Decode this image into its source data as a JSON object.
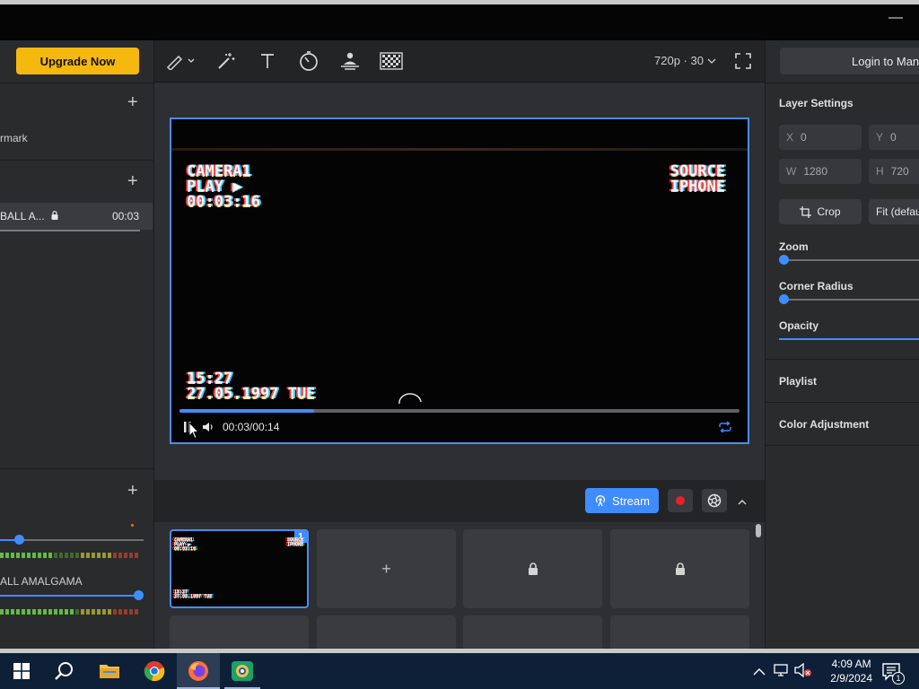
{
  "left_panel": {
    "upgrade_label": "Upgrade Now",
    "layers_item": "rmark",
    "source_item": {
      "name": "BALL A...",
      "time": "00:03"
    },
    "audio_item": "ALL AMALGAMA"
  },
  "toolbar": {
    "resolution": "720p · 30",
    "tools": [
      "pen-icon",
      "magic-wand-icon",
      "text-icon",
      "timer-icon",
      "presenter-icon",
      "mosaic-icon"
    ]
  },
  "preview": {
    "vhs_top_left": [
      "CAMERA1",
      "PLAY ▶",
      "00:03:16"
    ],
    "vhs_top_right": [
      "SOURCE",
      "IPHONE"
    ],
    "vhs_bottom_left": [
      "15:27",
      "27.05.1997 TUE"
    ],
    "time": "00:03/00:14",
    "progress_fraction": 0.24
  },
  "right_panel": {
    "login_label": "Login to Manycam",
    "layer_settings_title": "Layer Settings",
    "x_label": "X",
    "x_value": "0",
    "y_label": "Y",
    "y_value": "0",
    "w_label": "W",
    "w_value": "1280",
    "h_label": "H",
    "h_value": "720",
    "crop_label": "Crop",
    "fit_label": "Fit (default)",
    "zoom_label": "Zoom",
    "corner_radius_label": "Corner Radius",
    "opacity_label": "Opacity",
    "playlist_label": "Playlist",
    "color_adjustment_label": "Color Adjustment"
  },
  "scene_bar": {
    "stream_label": "Stream",
    "active_badge": "1"
  },
  "taskbar": {
    "time": "4:09 AM",
    "date": "2/9/2024",
    "notification_count": "1"
  },
  "colors": {
    "accent": "#3f8cff",
    "upgrade": "#f5b80f",
    "panel": "#2a2b2d",
    "taskbar": "#0e2038"
  }
}
